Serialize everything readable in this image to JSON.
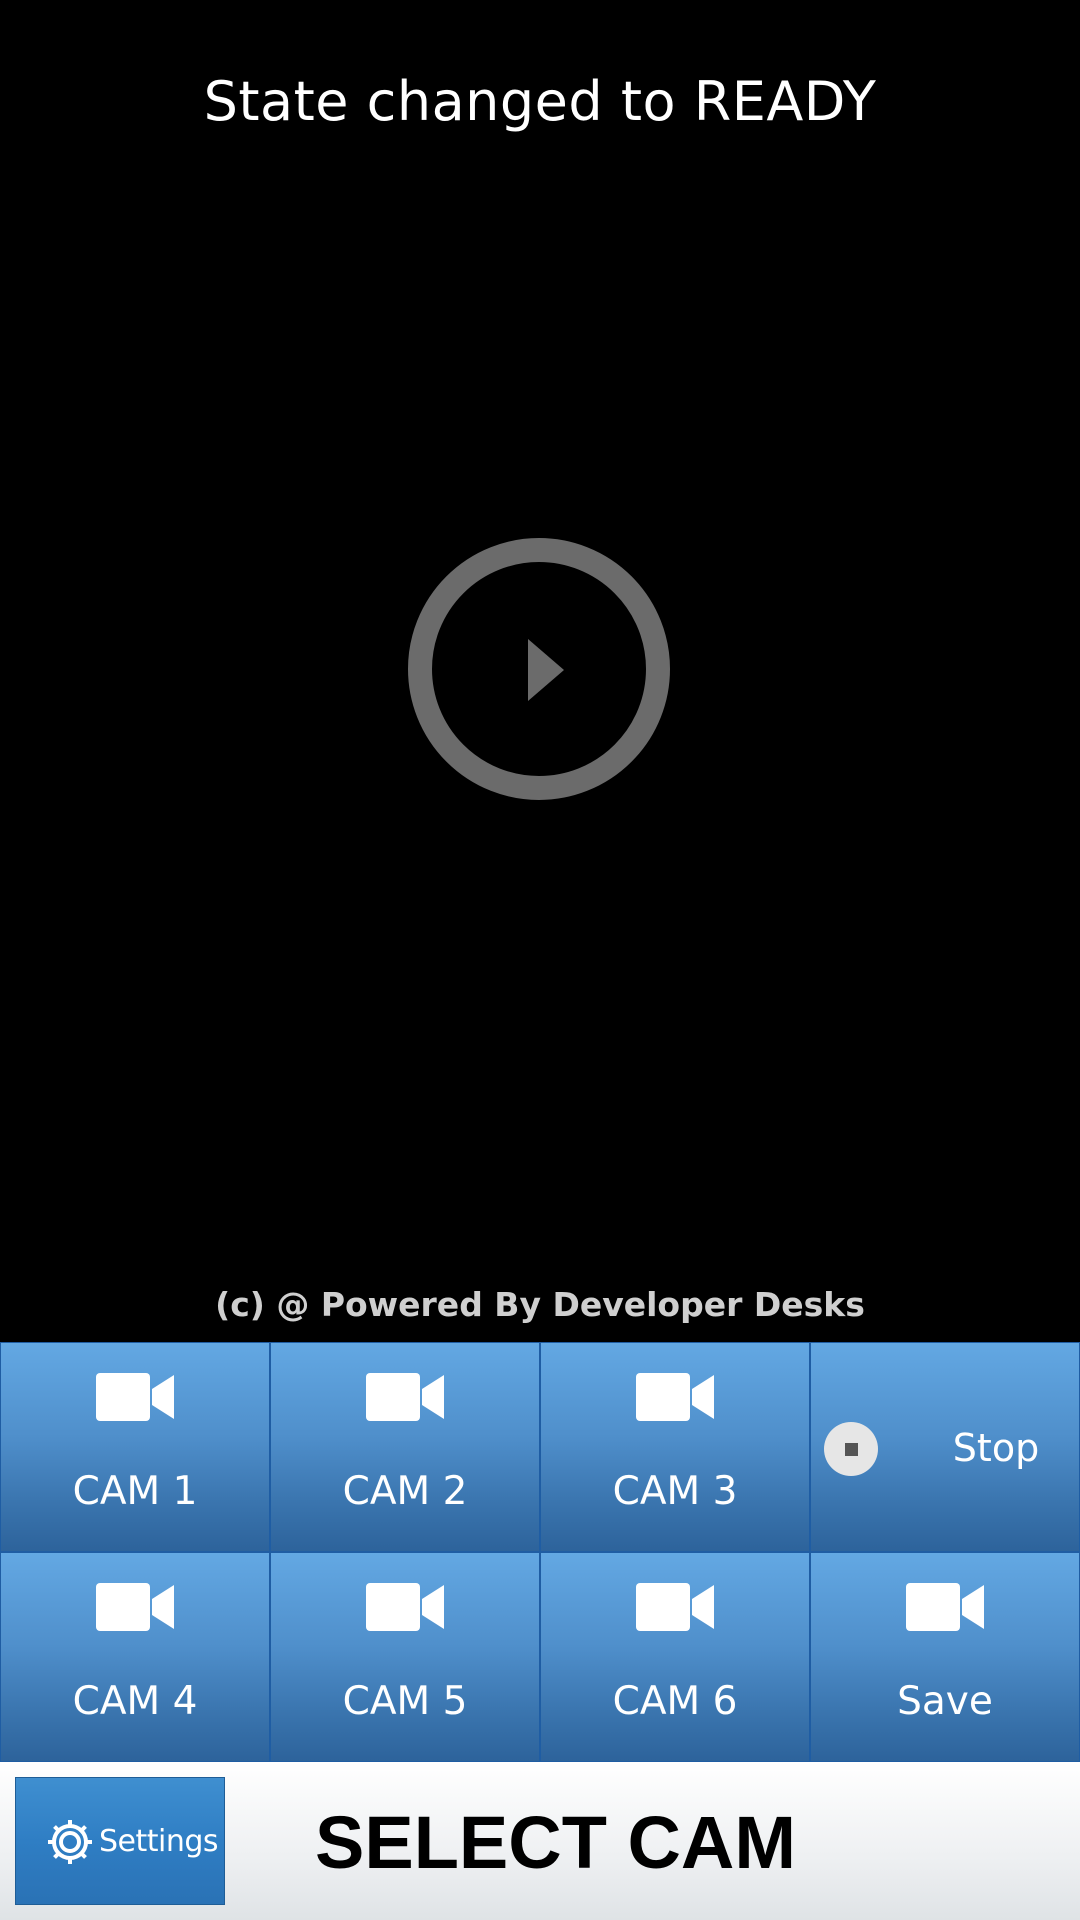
{
  "status": {
    "text": "State changed to READY"
  },
  "player": {
    "play_icon": "play-circle-icon",
    "icon_color": "#6b6b6b"
  },
  "footer": {
    "credit": "(c) @ Powered By Developer Desks"
  },
  "buttons": {
    "row1": [
      {
        "label": "CAM 1",
        "icon": "video-camera-icon"
      },
      {
        "label": "CAM 2",
        "icon": "video-camera-icon"
      },
      {
        "label": "CAM 3",
        "icon": "video-camera-icon"
      }
    ],
    "stop": {
      "label": "Stop",
      "icon": "stop-icon"
    },
    "row2": [
      {
        "label": "CAM 4",
        "icon": "video-camera-icon"
      },
      {
        "label": "CAM 5",
        "icon": "video-camera-icon"
      },
      {
        "label": "CAM 6",
        "icon": "video-camera-icon"
      },
      {
        "label": "Save",
        "icon": "video-camera-icon"
      }
    ]
  },
  "bottom_bar": {
    "settings_label": "Settings",
    "settings_icon": "gear-icon",
    "title": "SELECT CAM"
  },
  "colors": {
    "button_blue": "#4f8fcb",
    "background": "#000000"
  }
}
